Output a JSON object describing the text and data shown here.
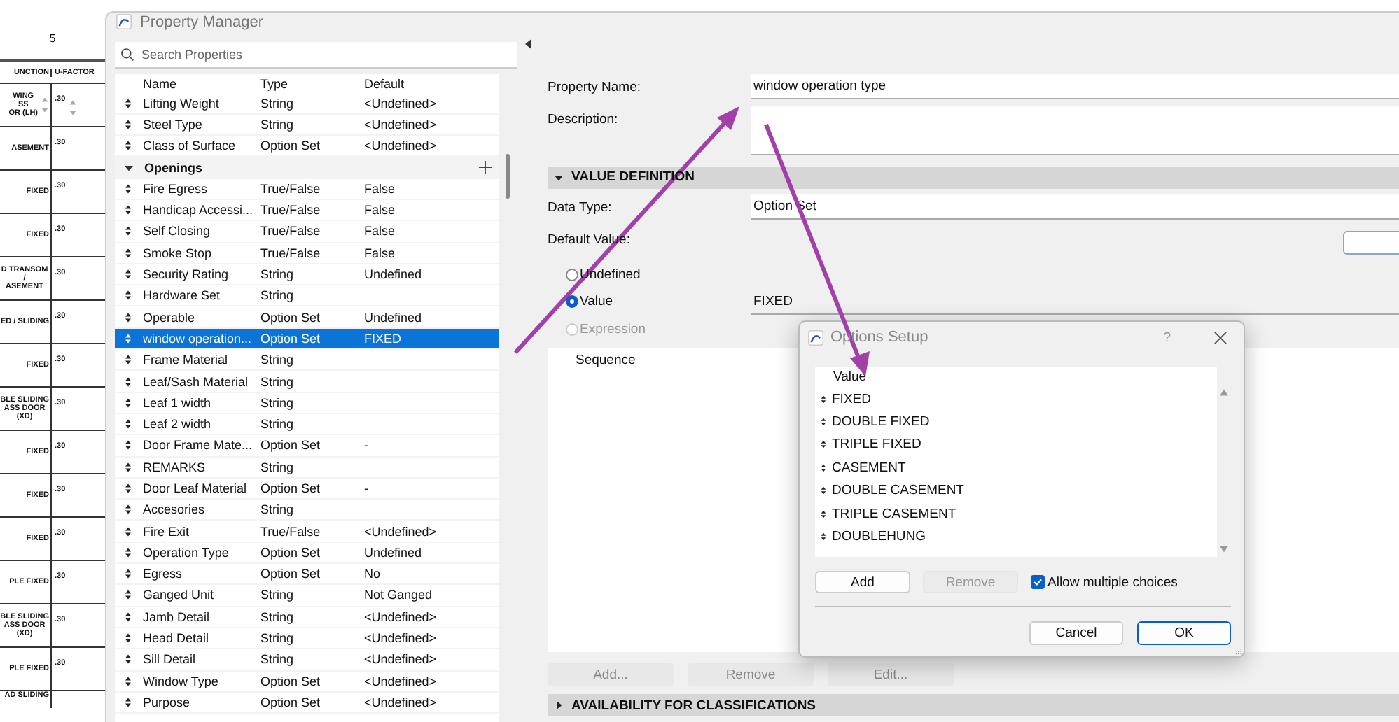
{
  "background_schedule": {
    "ruler_mark": "5",
    "columns": [
      "UNCTION",
      "U-FACTOR"
    ],
    "rows": [
      {
        "function": "WING\nSS\nOR (LH)",
        "u_factor": ".30",
        "spinner": true
      },
      {
        "function": "ASEMENT",
        "u_factor": ".30",
        "spinner": false
      },
      {
        "function": "FIXED",
        "u_factor": ".30",
        "spinner": false
      },
      {
        "function": "FIXED",
        "u_factor": ".30",
        "spinner": false
      },
      {
        "function": "D TRANSOM /\nASEMENT",
        "u_factor": ".30",
        "spinner": false
      },
      {
        "function": "ED / SLIDING",
        "u_factor": ".30",
        "spinner": false
      },
      {
        "function": "FIXED",
        "u_factor": ".30",
        "spinner": false
      },
      {
        "function": "BLE SLIDING\nASS DOOR\n(XD)",
        "u_factor": ".30",
        "spinner": false
      },
      {
        "function": "FIXED",
        "u_factor": ".30",
        "spinner": false
      },
      {
        "function": "FIXED",
        "u_factor": ".30",
        "spinner": false
      },
      {
        "function": "FIXED",
        "u_factor": ".30",
        "spinner": false
      },
      {
        "function": "PLE FIXED",
        "u_factor": ".30",
        "spinner": false
      },
      {
        "function": "BLE SLIDING\nASS DOOR\n(XD)",
        "u_factor": ".30",
        "spinner": false
      },
      {
        "function": "PLE FIXED",
        "u_factor": ".30",
        "spinner": false
      },
      {
        "function": "AD SLIDING",
        "u_factor": "",
        "spinner": false
      }
    ]
  },
  "window": {
    "title": "Property Manager"
  },
  "search": {
    "placeholder": "Search Properties"
  },
  "property_table": {
    "columns": [
      "Name",
      "Type",
      "Default"
    ],
    "rows": [
      {
        "kind": "property",
        "name": "Lifting Weight",
        "type": "String",
        "default": "<Undefined>",
        "selected": false
      },
      {
        "kind": "property",
        "name": "Steel Type",
        "type": "String",
        "default": "<Undefined>",
        "selected": false
      },
      {
        "kind": "property",
        "name": "Class of Surface",
        "type": "Option Set",
        "default": "<Undefined>",
        "selected": false
      },
      {
        "kind": "group",
        "name": "Openings",
        "expanded": true
      },
      {
        "kind": "property",
        "name": "Fire Egress",
        "type": "True/False",
        "default": "False",
        "selected": false
      },
      {
        "kind": "property",
        "name": "Handicap Accessi...",
        "type": "True/False",
        "default": "False",
        "selected": false
      },
      {
        "kind": "property",
        "name": "Self Closing",
        "type": "True/False",
        "default": "False",
        "selected": false
      },
      {
        "kind": "property",
        "name": "Smoke Stop",
        "type": "True/False",
        "default": "False",
        "selected": false
      },
      {
        "kind": "property",
        "name": "Security Rating",
        "type": "String",
        "default": "Undefined",
        "selected": false
      },
      {
        "kind": "property",
        "name": "Hardware Set",
        "type": "String",
        "default": "",
        "selected": false
      },
      {
        "kind": "property",
        "name": "Operable",
        "type": "Option Set",
        "default": "Undefined",
        "selected": false
      },
      {
        "kind": "property",
        "name": "window operation...",
        "type": "Option Set",
        "default": "FIXED",
        "selected": true
      },
      {
        "kind": "property",
        "name": "Frame Material",
        "type": "String",
        "default": "",
        "selected": false
      },
      {
        "kind": "property",
        "name": "Leaf/Sash Material",
        "type": "String",
        "default": "",
        "selected": false
      },
      {
        "kind": "property",
        "name": "Leaf 1 width",
        "type": "String",
        "default": "",
        "selected": false
      },
      {
        "kind": "property",
        "name": "Leaf 2 width",
        "type": "String",
        "default": "",
        "selected": false
      },
      {
        "kind": "property",
        "name": "Door Frame Mate...",
        "type": "Option Set",
        "default": "-",
        "selected": false
      },
      {
        "kind": "property",
        "name": "REMARKS",
        "type": "String",
        "default": "",
        "selected": false
      },
      {
        "kind": "property",
        "name": "Door Leaf Material",
        "type": "Option Set",
        "default": "-",
        "selected": false
      },
      {
        "kind": "property",
        "name": "Accesories",
        "type": "String",
        "default": "",
        "selected": false
      },
      {
        "kind": "property",
        "name": "Fire Exit",
        "type": "True/False",
        "default": "<Undefined>",
        "selected": false
      },
      {
        "kind": "property",
        "name": "Operation Type",
        "type": "Option Set",
        "default": "Undefined",
        "selected": false
      },
      {
        "kind": "property",
        "name": "Egress",
        "type": "Option Set",
        "default": "No",
        "selected": false
      },
      {
        "kind": "property",
        "name": "Ganged Unit",
        "type": "String",
        "default": "Not Ganged",
        "selected": false
      },
      {
        "kind": "property",
        "name": "Jamb Detail",
        "type": "String",
        "default": "<Undefined>",
        "selected": false
      },
      {
        "kind": "property",
        "name": "Head Detail",
        "type": "String",
        "default": "<Undefined>",
        "selected": false
      },
      {
        "kind": "property",
        "name": "Sill Detail",
        "type": "String",
        "default": "<Undefined>",
        "selected": false
      },
      {
        "kind": "property",
        "name": "Window Type",
        "type": "Option Set",
        "default": "<Undefined>",
        "selected": false
      },
      {
        "kind": "property",
        "name": "Purpose",
        "type": "Option Set",
        "default": "<Undefined>",
        "selected": false
      }
    ]
  },
  "details": {
    "property_name_label": "Property Name:",
    "property_name": "window operation type",
    "description_label": "Description:",
    "value_definition": {
      "title": "VALUE DEFINITION",
      "expanded": true
    },
    "data_type_label": "Data Type:",
    "data_type": "Option Set",
    "default_value_label": "Default Value:",
    "default_options": [
      {
        "label": "Undefined",
        "selected": false,
        "disabled": false
      },
      {
        "label": "Value",
        "selected": true,
        "disabled": false
      },
      {
        "label": "Expression",
        "selected": false,
        "disabled": true
      }
    ],
    "value": "FIXED",
    "sequence_header": "Sequence",
    "buttons": [
      {
        "label": "Add...",
        "disabled": true
      },
      {
        "label": "Remove",
        "disabled": true
      },
      {
        "label": "Edit...",
        "disabled": true
      }
    ],
    "availability": {
      "title": "AVAILABILITY FOR CLASSIFICATIONS",
      "expanded": false
    }
  },
  "dialog": {
    "title": "Options Setup",
    "help": "?",
    "column": "Value",
    "options": [
      "FIXED",
      "DOUBLE FIXED",
      "TRIPLE FIXED",
      "CASEMENT",
      "DOUBLE CASEMENT",
      "TRIPLE CASEMENT",
      "DOUBLEHUNG"
    ],
    "buttons": [
      {
        "label": "Add",
        "disabled": false
      },
      {
        "label": "Remove",
        "disabled": true
      }
    ],
    "allow_multiple": {
      "label": "Allow multiple choices",
      "checked": true
    },
    "footer_buttons": [
      {
        "label": "Cancel",
        "default": false
      },
      {
        "label": "OK",
        "default": true
      }
    ]
  }
}
